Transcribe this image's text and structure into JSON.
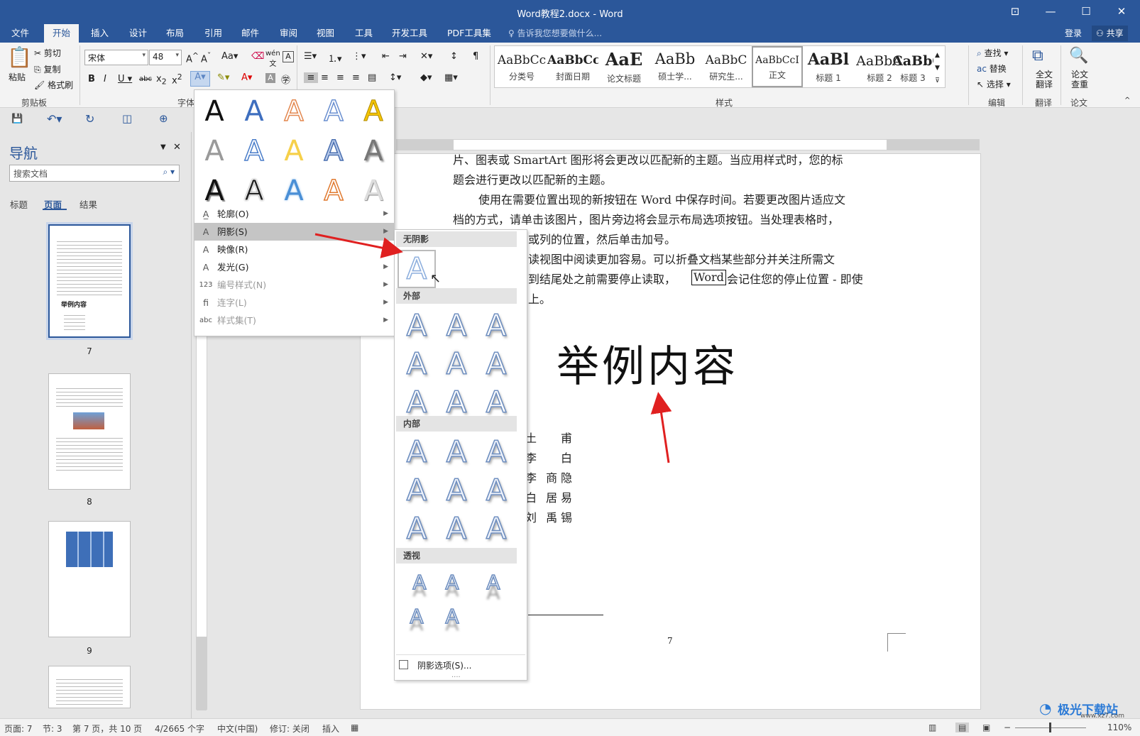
{
  "window": {
    "title": "Word教程2.docx - Word"
  },
  "tabs": {
    "file": "文件",
    "home": "开始",
    "insert": "插入",
    "design": "设计",
    "layout": "布局",
    "references": "引用",
    "mailings": "邮件",
    "review": "审阅",
    "view": "视图",
    "tools": "工具",
    "developer": "开发工具",
    "pdf": "PDF工具集",
    "tellme": "告诉我您想要做什么...",
    "login": "登录",
    "share": "共享"
  },
  "ribbon": {
    "clipboard": {
      "paste": "粘贴",
      "cut": "剪切",
      "copy": "复制",
      "format_painter": "格式刷",
      "label": "剪贴板"
    },
    "font": {
      "name": "宋体",
      "size": "48",
      "label": "字体"
    },
    "styles": {
      "label": "样式",
      "items": [
        {
          "preview": "AaBbCc",
          "name": "分类号"
        },
        {
          "preview": "AaBbCc",
          "name": "封面日期"
        },
        {
          "preview": "AaE",
          "name": "论文标题"
        },
        {
          "preview": "AaBb",
          "name": "硕士学..."
        },
        {
          "preview": "AaBbC",
          "name": "研究生..."
        },
        {
          "preview": "AaBbCcI",
          "name": "正文"
        },
        {
          "preview": "AaBl",
          "name": "标题 1"
        },
        {
          "preview": "AaBbC",
          "name": "标题 2"
        },
        {
          "preview": "AaBbC",
          "name": "标题 3"
        }
      ]
    },
    "editing": {
      "find": "查找",
      "replace": "替换",
      "select": "选择",
      "label": "编辑"
    },
    "translate": {
      "btn": "全文翻译",
      "label": "翻译"
    },
    "paper": {
      "btn": "论文查重",
      "label": "论文"
    }
  },
  "nav": {
    "title": "导航",
    "search_placeholder": "搜索文档",
    "tabs": [
      "标题",
      "页面",
      "结果"
    ],
    "pages": [
      "7",
      "8",
      "9"
    ],
    "thumb_heading": "举例内容"
  },
  "document": {
    "lines": [
      "片、图表或 SmartArt 图形将会更改以匹配新的主题。当应用样式时，您的标",
      "题会进行更改以匹配新的主题。",
      "使用在需要位置出现的新按钮在 Word 中保存时间。若要更改图片适应文",
      "档的方式，请单击该图片，图片旁边将会显示布局选项按钮。当处理表格时，",
      "或列的位置，然后单击加号。",
      "读视图中阅读更加容易。可以折叠文档某些部分并关注所需文",
      "到结尾处之前需要停止读取，",
      "会记住您的停止位置 - 即使",
      "上。"
    ],
    "word_box": "Word",
    "title": "举例内容",
    "poets": [
      "甫",
      "白",
      "隐",
      "易",
      "锡"
    ],
    "poets_mid": [
      "土",
      "李",
      "李 商",
      "白 居",
      "刘 禹"
    ],
    "page_number": "7"
  },
  "effects_menu": {
    "items": [
      {
        "label": "轮廓(O)"
      },
      {
        "label": "阴影(S)"
      },
      {
        "label": "映像(R)"
      },
      {
        "label": "发光(G)"
      },
      {
        "label": "编号样式(N)"
      },
      {
        "label": "连字(L)"
      },
      {
        "label": "样式集(T)"
      }
    ],
    "letter": "A"
  },
  "shadow_menu": {
    "sections": [
      "无阴影",
      "外部",
      "内部",
      "透视"
    ],
    "options": "阴影选项(S)...",
    "dots": "...."
  },
  "status": {
    "page": "页面: 7",
    "section": "节: 3",
    "page_of": "第 7 页，共 10 页",
    "words": "4/2665 个字",
    "lang": "中文(中国)",
    "track": "修订: 关闭",
    "mode": "插入",
    "zoom": "110%"
  },
  "watermark": {
    "brand": "极光下载站",
    "url": "www.xz7.com"
  },
  "colors": {
    "accent": "#2b579a",
    "arrow": "#e02020"
  }
}
